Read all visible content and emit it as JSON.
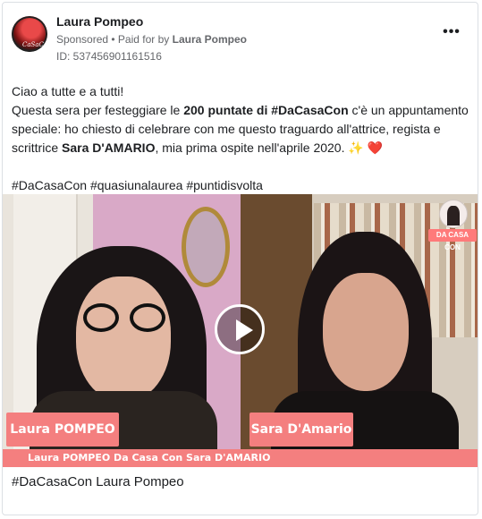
{
  "post": {
    "page_name": "Laura Pompeo",
    "avatar_tag": "CaSaCon",
    "sponsored_label": "Sponsored",
    "paid_for_prefix": " • Paid for by ",
    "paid_for_name": "Laura Pompeo",
    "ad_id": "ID: 537456901161516",
    "more_label": "•••"
  },
  "message": {
    "greeting": "Ciao a tutte e a tutti!",
    "line_a": "Questa sera per festeggiare le ",
    "bold_a": "200 puntate di #DaCasaCon",
    "line_b": " c'è un appuntamento speciale: ho chiesto di celebrare con me questo traguardo all'attrice, regista e scrittrice ",
    "bold_b": "Sara D'AMARIO",
    "line_c": ", mia prima ospite nell'aprile 2020. ",
    "sparkle": "✨",
    "heart": "❤️",
    "hashtags": "#DaCasaCon #quasiunalaurea #puntidisvolta"
  },
  "video": {
    "logo_label": "DA CASA CON",
    "left_name": "Laura POMPEO",
    "right_name": "Sara D'Amario",
    "caption": "Laura POMPEO Da Casa Con Sara D'AMARIO"
  },
  "footer": {
    "link_title": "#DaCasaCon Laura Pompeo"
  },
  "colors": {
    "accent_pink": "#f47f7f",
    "secondary_text": "#65676b"
  }
}
